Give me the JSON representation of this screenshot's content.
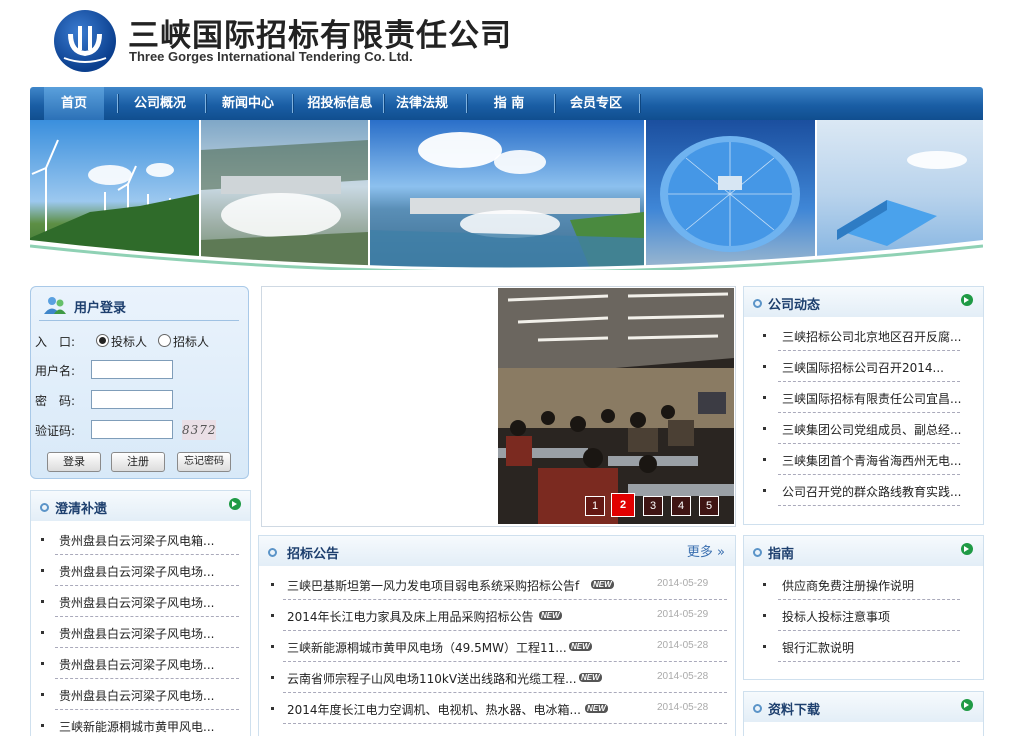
{
  "header": {
    "title_cn": "三峡国际招标有限责任公司",
    "title_en": "Three Gorges International Tendering Co. Ltd."
  },
  "nav": {
    "items": [
      {
        "label": "首页"
      },
      {
        "label": "公司概况"
      },
      {
        "label": "新闻中心"
      },
      {
        "label": "招投标信息"
      },
      {
        "label": "法律法规"
      },
      {
        "label": "指 南"
      },
      {
        "label": "会员专区"
      }
    ]
  },
  "login": {
    "title": "用户登录",
    "entry_label": "入　口:",
    "role_bidder": "投标人",
    "role_tenderer": "招标人",
    "username_label": "用户名:",
    "password_label": "密　码:",
    "captcha_label": "验证码:",
    "username_value": "",
    "password_value": "",
    "captcha_value": "",
    "captcha_code": "8372",
    "login_button": "登录",
    "register_button": "注册",
    "forgot_button": "忘记密码"
  },
  "clarify": {
    "title": "澄清补遗",
    "items": [
      {
        "text": "贵州盘县白云河梁子风电箱..."
      },
      {
        "text": "贵州盘县白云河梁子风电场..."
      },
      {
        "text": "贵州盘县白云河梁子风电场..."
      },
      {
        "text": "贵州盘县白云河梁子风电场..."
      },
      {
        "text": "贵州盘县白云河梁子风电场..."
      },
      {
        "text": "贵州盘县白云河梁子风电场..."
      },
      {
        "text": "三峡新能源桐城市黄甲风电..."
      }
    ]
  },
  "slideshow": {
    "pages": [
      "1",
      "2",
      "3",
      "4",
      "5"
    ],
    "active_page": "2"
  },
  "notice": {
    "title": "招标公告",
    "more": "更多",
    "new_badge": "NEW",
    "items": [
      {
        "text": "三峡巴基斯坦第一风力发电项目弱电系统采购招标公告f",
        "date": "2014-05-29"
      },
      {
        "text": "2014年长江电力家具及床上用品采购招标公告",
        "date": "2014-05-29"
      },
      {
        "text": "三峡新能源桐城市黄甲风电场（49.5MW）工程11...",
        "date": "2014-05-28"
      },
      {
        "text": "云南省师宗程子山风电场110kV送出线路和光缆工程...",
        "date": "2014-05-28"
      },
      {
        "text": "2014年度长江电力空调机、电视机、热水器、电冰箱...",
        "date": "2014-05-28"
      }
    ]
  },
  "company_news": {
    "title": "公司动态",
    "items": [
      {
        "text": "三峡招标公司北京地区召开反腐..."
      },
      {
        "text": "三峡国际招标公司召开2014..."
      },
      {
        "text": "三峡国际招标有限责任公司宜昌..."
      },
      {
        "text": "三峡集团公司党组成员、副总经..."
      },
      {
        "text": "三峡集团首个青海省海西州无电..."
      },
      {
        "text": "公司召开党的群众路线教育实践..."
      }
    ]
  },
  "guide": {
    "title": "指南",
    "items": [
      {
        "text": "供应商免费注册操作说明"
      },
      {
        "text": "投标人投标注意事项"
      },
      {
        "text": "银行汇款说明"
      }
    ]
  },
  "downloads": {
    "title": "资料下载"
  },
  "colors": {
    "nav_blue": "#1a5ea5",
    "accent_red": "#e20000",
    "heading": "#1d3f6e"
  }
}
